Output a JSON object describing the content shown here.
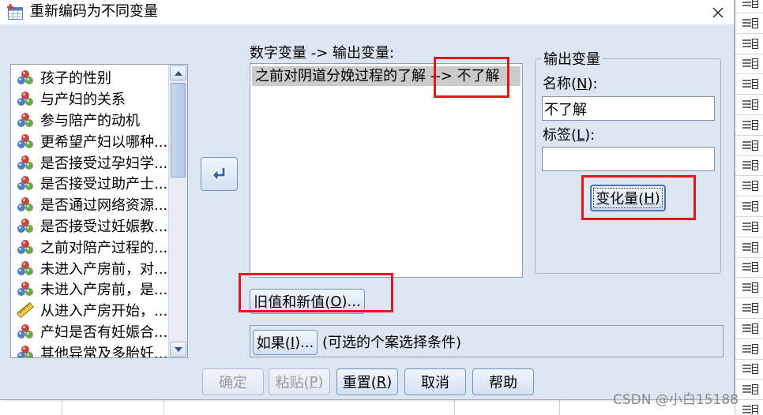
{
  "window": {
    "title": "重新编码为不同变量",
    "app_icon": "spss-recode-app-icon",
    "close_icon": "close-icon"
  },
  "source_list": {
    "items": [
      {
        "label": "孩子的性别",
        "icon": "nominal-icon"
      },
      {
        "label": "与产妇的关系",
        "icon": "nominal-icon"
      },
      {
        "label": "参与陪产的动机",
        "icon": "nominal-icon"
      },
      {
        "label": "更希望产妇以哪种...",
        "icon": "nominal-icon"
      },
      {
        "label": "是否接受过孕妇学...",
        "icon": "nominal-icon"
      },
      {
        "label": "是否接受过助产士...",
        "icon": "nominal-icon"
      },
      {
        "label": "是否通过网络资源...",
        "icon": "nominal-icon"
      },
      {
        "label": "是否接受过妊娠教...",
        "icon": "nominal-icon"
      },
      {
        "label": "之前对陪产过程的...",
        "icon": "nominal-icon"
      },
      {
        "label": "未进入产房前，对...",
        "icon": "nominal-icon"
      },
      {
        "label": "未进入产房前，是...",
        "icon": "nominal-icon"
      },
      {
        "label": "从进入产房开始，...",
        "icon": "scale-ruler-icon"
      },
      {
        "label": "产妇是否有妊娠合...",
        "icon": "nominal-icon"
      },
      {
        "label": "其他异常及多胎妊...",
        "icon": "nominal-icon"
      }
    ]
  },
  "move_button": {
    "icon": "move-left-arrow-icon"
  },
  "mapping": {
    "label": "数字变量 -> 输出变量:",
    "rows": [
      {
        "text": "之前对阴道分娩过程的了解 --> 不了解",
        "selected": true
      }
    ]
  },
  "output_variable": {
    "group_label": "输出变量",
    "name_label": "名称(N):",
    "name_value": "不了解",
    "label_label": "标签(L):",
    "label_value": "",
    "change_button": "变化量(H)"
  },
  "old_new_button": "旧值和新值(O)...",
  "condition": {
    "if_button": "如果(I)...",
    "hint": "(可选的个案选择条件)"
  },
  "footer_buttons": [
    {
      "label": "确定",
      "enabled": false
    },
    {
      "label": "粘贴(P)",
      "enabled": false
    },
    {
      "label": "重置(R)",
      "enabled": true
    },
    {
      "label": "取消",
      "enabled": true
    },
    {
      "label": "帮助",
      "enabled": true
    }
  ],
  "side_panel": {
    "icon": "variable-role-icon"
  },
  "watermark": "CSDN @小白15188",
  "colors": {
    "dialog_bg": "#dde7f3",
    "selection": "#cbcbcb",
    "annotation": "#e8141b",
    "button_border": "#7395c4"
  }
}
